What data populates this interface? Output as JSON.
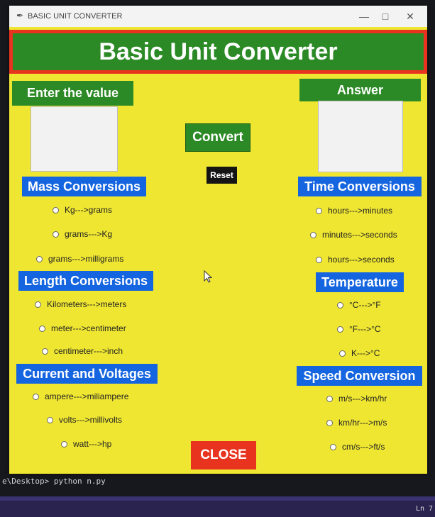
{
  "window": {
    "title": "BASIC UNIT CONVERTER"
  },
  "header": {
    "title": "Basic Unit Converter"
  },
  "input": {
    "label": "Enter the value",
    "value": ""
  },
  "answer": {
    "label": "Answer",
    "value": ""
  },
  "buttons": {
    "convert": "Convert",
    "reset": "Reset",
    "close": "CLOSE"
  },
  "mass": {
    "title": "Mass Conversions",
    "options": [
      "Kg--->grams",
      "grams--->Kg",
      "grams--->milligrams"
    ]
  },
  "length": {
    "title": "Length Conversions",
    "options": [
      "Kilometers--->meters",
      "meter--->centimeter",
      "centimeter--->inch"
    ]
  },
  "current": {
    "title": "Current and Voltages",
    "options": [
      "ampere--->miliampere",
      "volts--->millivolts",
      "watt--->hp"
    ]
  },
  "time": {
    "title": "Time Conversions",
    "options": [
      "hours--->minutes",
      "minutes--->seconds",
      "hours--->seconds"
    ]
  },
  "temperature": {
    "title": "Temperature",
    "options": [
      "°C--->°F",
      "°F--->°C",
      "K--->°C"
    ]
  },
  "speed": {
    "title": "Speed Conversion",
    "options": [
      "m/s--->km/hr",
      "km/hr--->m/s",
      "cm/s--->ft/s"
    ]
  },
  "terminal": {
    "prompt_line": "e\\Desktop> python n.py",
    "status_right": "Ln 7"
  },
  "colors": {
    "background": "#efe632",
    "green": "#2c8a26",
    "blue": "#1565e0",
    "red": "#e8341f"
  }
}
